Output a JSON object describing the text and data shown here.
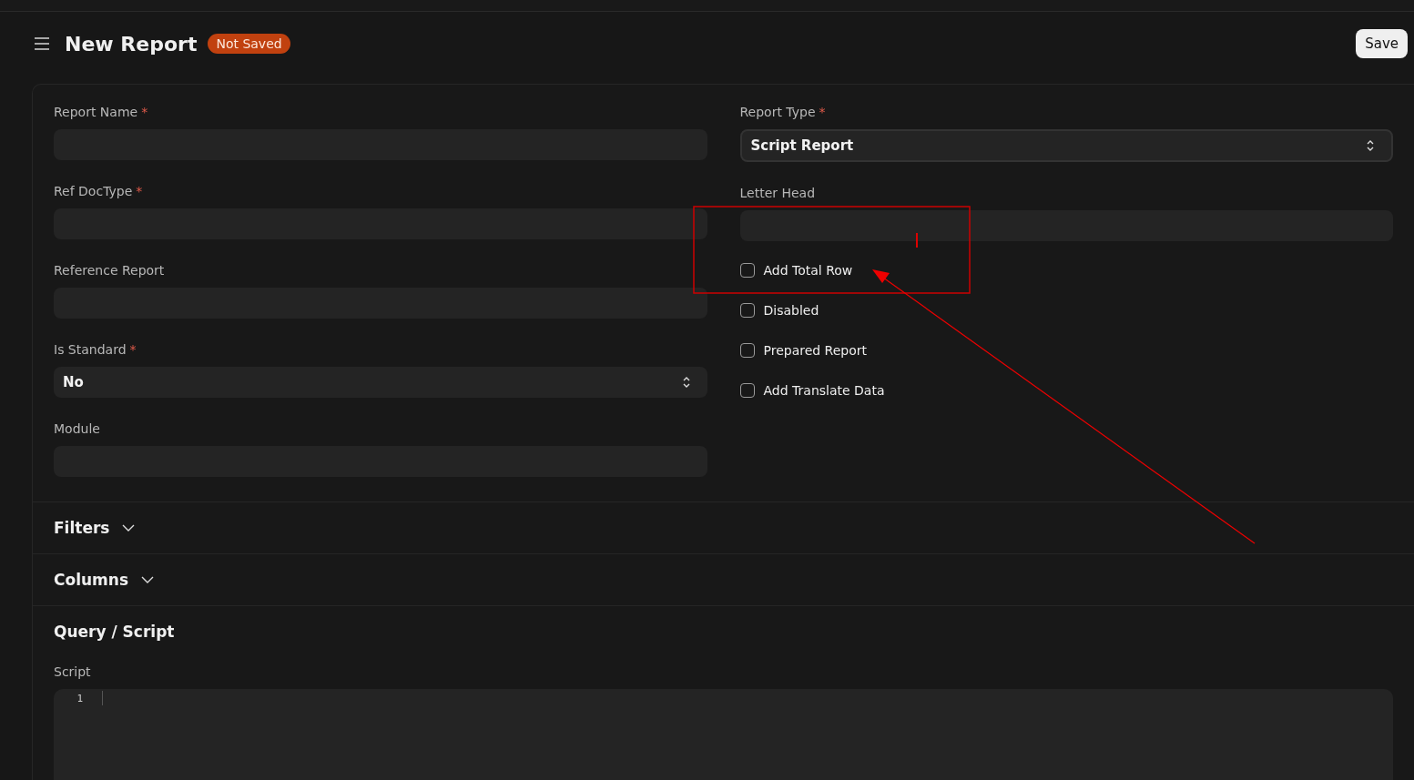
{
  "header": {
    "title": "New Report",
    "status": "Not Saved",
    "save_button": "Save"
  },
  "left_fields": [
    {
      "kind": "input",
      "label": "Report Name",
      "required_mark": "*"
    },
    {
      "kind": "input",
      "label": "Ref DocType",
      "required_mark": "*"
    },
    {
      "kind": "input",
      "label": "Reference Report"
    },
    {
      "kind": "select",
      "label": "Is Standard",
      "required_mark": "*",
      "value": "No"
    },
    {
      "kind": "input",
      "label": "Module"
    }
  ],
  "right_fields": [
    {
      "kind": "select",
      "label": "Report Type",
      "required_mark": "*",
      "value": "Script Report"
    },
    {
      "kind": "input",
      "label": "Letter Head"
    }
  ],
  "checkboxes": [
    {
      "label": "Add Total Row",
      "checked": false
    },
    {
      "label": "Disabled",
      "checked": false
    },
    {
      "label": "Prepared Report",
      "checked": false
    },
    {
      "label": "Add Translate Data",
      "checked": false
    }
  ],
  "sections": [
    {
      "title": "Filters",
      "expanded": false
    },
    {
      "title": "Columns",
      "expanded": false
    },
    {
      "title": "Query / Script",
      "expanded": true,
      "field_label": "Script",
      "line_numbers": [
        "1"
      ]
    }
  ]
}
